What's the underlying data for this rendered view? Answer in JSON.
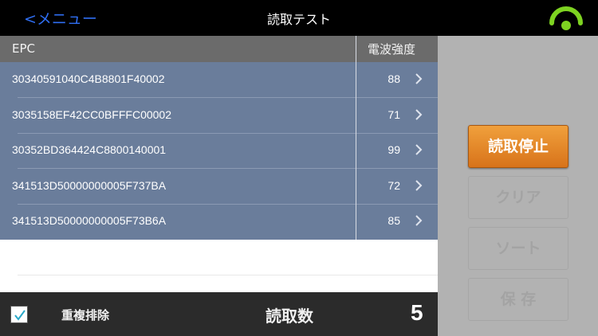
{
  "topbar": {
    "back_label": "<メニュー",
    "title": "読取テスト",
    "signal_icon": "signal-indicator-icon",
    "signal_color": "#7ed321"
  },
  "table": {
    "col_epc": "EPC",
    "col_rssi": "電波強度",
    "rows": [
      {
        "epc": "30340591040C4B8801F40002",
        "rssi": "88"
      },
      {
        "epc": "3035158EF42CC0BFFFC00002",
        "rssi": "71"
      },
      {
        "epc": "30352BD364424C8800140001",
        "rssi": "99"
      },
      {
        "epc": "341513D50000000005F737BA",
        "rssi": "72"
      },
      {
        "epc": "341513D50000000005F73B6A",
        "rssi": "85"
      }
    ]
  },
  "bottom": {
    "dedup_checked": true,
    "dedup_label": "重複排除",
    "count_label": "読取数",
    "count_value": "5"
  },
  "side": {
    "stop_label": "読取停止",
    "clear_label": "クリア",
    "sort_label": "ソート",
    "save_label": "保 存"
  },
  "colors": {
    "accent_orange": "#e38a2a",
    "row_blue": "#6a7d9b",
    "link_blue": "#2f6ef2"
  }
}
